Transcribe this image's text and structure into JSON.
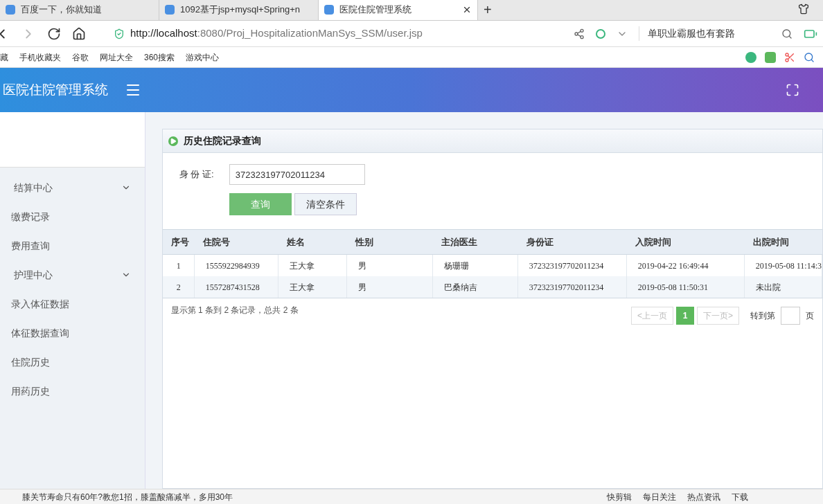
{
  "browser": {
    "tabs": [
      {
        "title": "百度一下，你就知道",
        "selected": false
      },
      {
        "title": "1092基于jsp+mysql+Spring+n",
        "selected": false
      },
      {
        "title": "医院住院管理系统",
        "selected": true
      }
    ],
    "new_tab": "+",
    "url_host": "http://localhost",
    "url_rest": ":8080/Proj_HospitalizationManSys_SSM/user.jsp",
    "search_text": "单职业霸服也有套路",
    "bookmarks": [
      "藏",
      "手机收藏夹",
      "谷歌",
      "网址大全",
      "360搜索",
      "游戏中心"
    ]
  },
  "app": {
    "title": "医院住院管理系统",
    "sidebar": [
      {
        "label": "结算中心",
        "expanded": true,
        "children": [
          {
            "label": "缴费记录"
          },
          {
            "label": "费用查询"
          }
        ]
      },
      {
        "label": "护理中心",
        "expanded": true,
        "children": [
          {
            "label": "录入体征数据"
          },
          {
            "label": "体征数据查询"
          },
          {
            "label": "住院历史"
          },
          {
            "label": "用药历史"
          }
        ]
      }
    ],
    "panel_title": "历史住院记录查询",
    "form": {
      "label": "身 份 证:",
      "value": "372323197702011234",
      "buttons": [
        {
          "label": "查询",
          "kind": "primary"
        },
        {
          "label": "清空条件",
          "kind": "default"
        }
      ]
    },
    "table": {
      "columns": [
        "序号",
        "住院号",
        "姓名",
        "性别",
        "主治医生",
        "身份证",
        "入院时间",
        "出院时间"
      ],
      "rows": [
        [
          "1",
          "1555922984939",
          "王大拿",
          "男",
          "杨珊珊",
          "372323197702011234",
          "2019-04-22 16:49:44",
          "2019-05-08 11:14:3"
        ],
        [
          "2",
          "1557287431528",
          "王大拿",
          "男",
          "巴桑纳吉",
          "372323197702011234",
          "2019-05-08 11:50:31",
          "未出院"
        ]
      ]
    },
    "summary": "显示第 1 条到 2 条记录，总共 2 条",
    "pagination": {
      "prev": "<上一页",
      "pages": [
        {
          "label": "1",
          "selected": true
        }
      ],
      "next": "下一页>",
      "goto": "转到第",
      "page_unit": "页"
    }
  },
  "status_bar": {
    "news": "膝关节寿命只有60年?教您1招，膝盖酸痛减半，多用30年",
    "items": [
      "快剪辑",
      "每日关注",
      "热点资讯",
      "下载"
    ]
  }
}
